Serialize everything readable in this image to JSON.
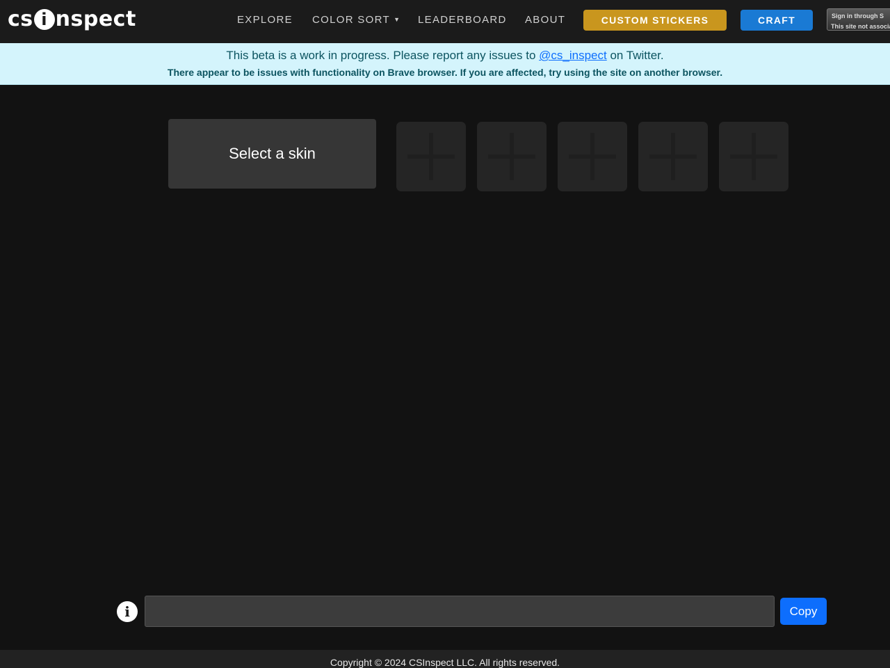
{
  "nav": {
    "logo_pre": "cs",
    "logo_i": "i",
    "logo_post": "nspect",
    "links": [
      "EXPLORE",
      "COLOR SORT",
      "LEADERBOARD",
      "ABOUT"
    ],
    "custom_stickers": "CUSTOM STICKERS",
    "craft": "CRAFT",
    "steam_line1": "Sign in through S",
    "steam_line2": "This site not associat",
    "colors": {
      "custom_stickers": "#c9961e",
      "craft": "#1a7ad4"
    }
  },
  "banner": {
    "text_before": "This beta is a work in progress. Please report any issues to ",
    "link": "@cs_inspect",
    "text_after": " on Twitter.",
    "warning": "There appear to be issues with functionality on Brave browser. If you are affected, try using the site on another browser."
  },
  "main": {
    "select_skin": "Select a skin",
    "sticker_slots": 5
  },
  "bottom": {
    "input_value": "",
    "copy": "Copy"
  },
  "footer": {
    "text": "Copyright © 2024 CSInspect LLC. All rights reserved."
  }
}
